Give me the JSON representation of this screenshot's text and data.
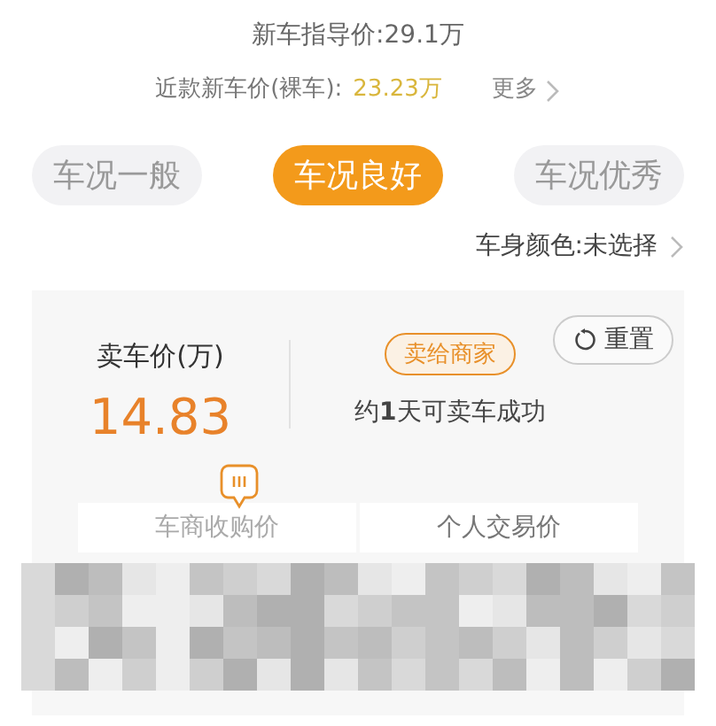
{
  "guide_price": "新车指导价:29.1万",
  "recent_price": {
    "label": "近款新车价(裸车):",
    "value": "23.23万",
    "more": "更多"
  },
  "conditions": [
    {
      "label": "车况一般",
      "selected": false
    },
    {
      "label": "车况良好",
      "selected": true
    },
    {
      "label": "车况优秀",
      "selected": false
    }
  ],
  "body_color": "车身颜色:未选择",
  "card": {
    "price_label": "卖车价(万)",
    "price": "14.83",
    "badge": "卖给商家",
    "reset": "重置",
    "note": "约**1**天可卖车成功",
    "price_types": [
      {
        "label": "车商收购价",
        "selected": true
      },
      {
        "label": "个人交易价",
        "selected": false
      }
    ]
  }
}
